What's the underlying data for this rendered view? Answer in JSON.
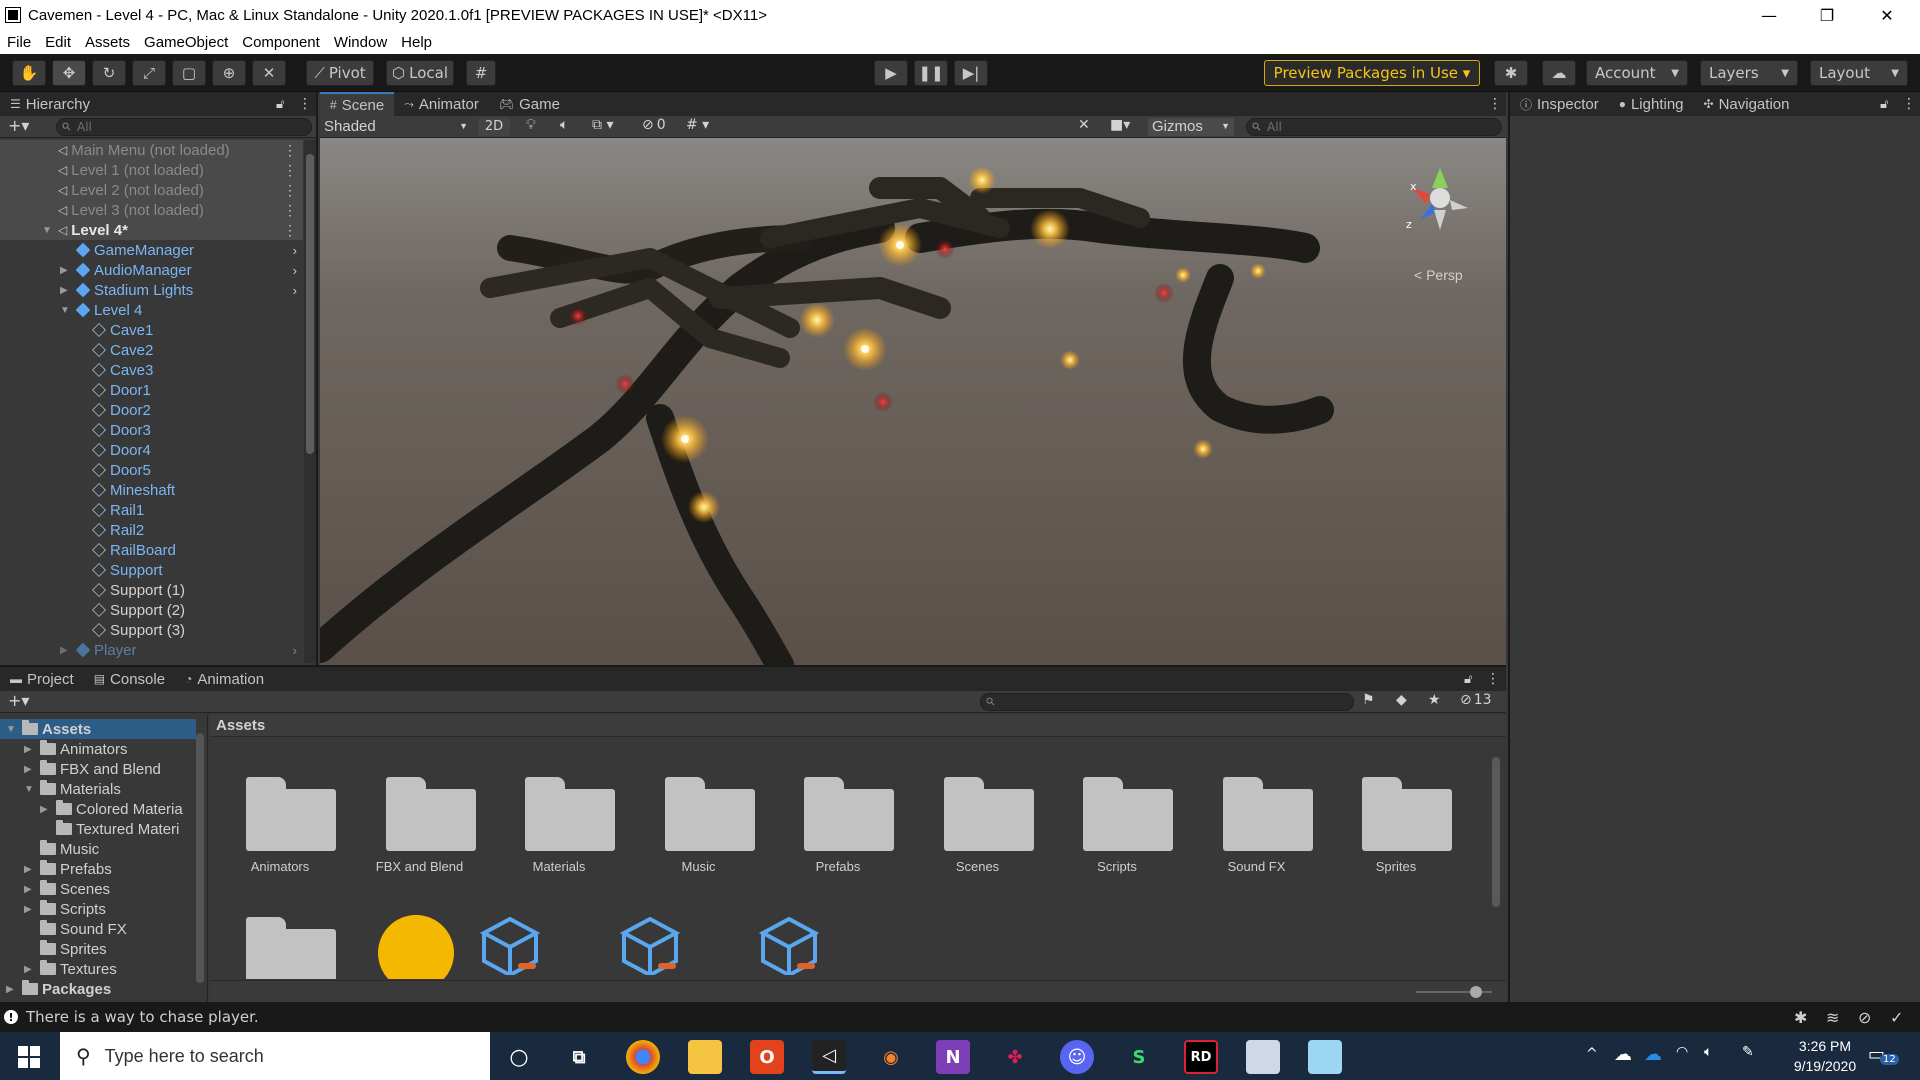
{
  "window": {
    "title": "Cavemen - Level 4 - PC, Mac & Linux Standalone - Unity 2020.1.0f1 [PREVIEW PACKAGES IN USE]* <DX11>"
  },
  "menu": [
    "File",
    "Edit",
    "Assets",
    "GameObject",
    "Component",
    "Window",
    "Help"
  ],
  "toolbar": {
    "pivot": "Pivot",
    "local": "Local",
    "preview_packages": "Preview Packages in Use ▾",
    "account": "Account",
    "layers": "Layers",
    "layout": "Layout"
  },
  "hierarchy": {
    "tab": "Hierarchy",
    "search_placeholder": "All",
    "rows": [
      {
        "label": "Main Menu (not loaded)"
      },
      {
        "label": "Level 1 (not loaded)"
      },
      {
        "label": "Level 2 (not loaded)"
      },
      {
        "label": "Level 3 (not loaded)"
      },
      {
        "label": "Level 4*"
      },
      {
        "label": "GameManager"
      },
      {
        "label": "AudioManager"
      },
      {
        "label": "Stadium Lights"
      },
      {
        "label": "Level 4"
      },
      {
        "label": "Cave1"
      },
      {
        "label": "Cave2"
      },
      {
        "label": "Cave3"
      },
      {
        "label": "Door1"
      },
      {
        "label": "Door2"
      },
      {
        "label": "Door3"
      },
      {
        "label": "Door4"
      },
      {
        "label": "Door5"
      },
      {
        "label": "Mineshaft"
      },
      {
        "label": "Rail1"
      },
      {
        "label": "Rail2"
      },
      {
        "label": "RailBoard"
      },
      {
        "label": "Support"
      },
      {
        "label": "Support (1)"
      },
      {
        "label": "Support (2)"
      },
      {
        "label": "Support (3)"
      },
      {
        "label": "Player"
      }
    ]
  },
  "scene": {
    "tabs": [
      "Scene",
      "Animator",
      "Game"
    ],
    "shading": "Shaded",
    "mode2d": "2D",
    "hidden_count": "0",
    "gizmos": "Gizmos",
    "search_placeholder": "All",
    "persp": "< Persp",
    "axis_x": "x",
    "axis_y": "y",
    "axis_z": "z"
  },
  "inspector": {
    "tabs": [
      "Inspector",
      "Lighting",
      "Navigation"
    ]
  },
  "project": {
    "tabs": [
      "Project",
      "Console",
      "Animation"
    ],
    "hidden_count": "13",
    "breadcrumb": "Assets",
    "tree": [
      {
        "label": "Assets"
      },
      {
        "label": "Animators"
      },
      {
        "label": "FBX and Blend"
      },
      {
        "label": "Materials"
      },
      {
        "label": "Colored Materia"
      },
      {
        "label": "Textured Materi"
      },
      {
        "label": "Music"
      },
      {
        "label": "Prefabs"
      },
      {
        "label": "Scenes"
      },
      {
        "label": "Scripts"
      },
      {
        "label": "Sound FX"
      },
      {
        "label": "Sprites"
      },
      {
        "label": "Textures"
      },
      {
        "label": "Packages"
      }
    ],
    "folders": [
      "Animators",
      "FBX and Blend",
      "Materials",
      "Music",
      "Prefabs",
      "Scenes",
      "Scripts",
      "Sound FX",
      "Sprites"
    ]
  },
  "status": {
    "message": "There is a way to chase player."
  },
  "taskbar": {
    "search_placeholder": "Type here to search",
    "time": "3:26 PM",
    "date": "9/19/2020",
    "notif_count": "12"
  }
}
